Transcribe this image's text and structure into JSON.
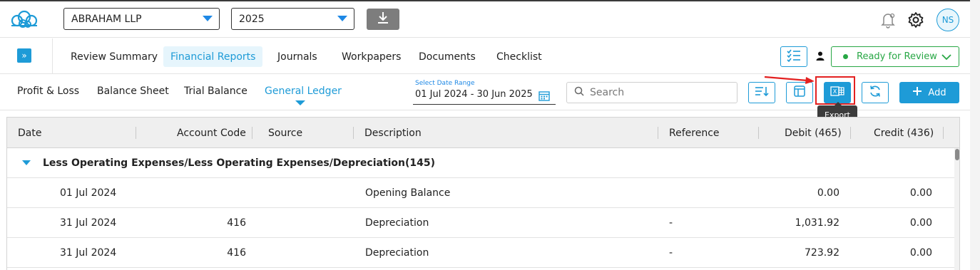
{
  "header": {
    "client_select": "ABRAHAM LLP",
    "year_select": "2025",
    "avatar_initials": "NS"
  },
  "nav": {
    "tabs": [
      "Review Summary",
      "Financial Reports",
      "Journals",
      "Workpapers",
      "Documents",
      "Checklist"
    ],
    "active_tab": "Financial Reports",
    "status_label": "Ready for Review",
    "status_color": "#28a745"
  },
  "toolbar": {
    "subtabs": [
      "Profit & Loss",
      "Balance Sheet",
      "Trial Balance",
      "General Ledger"
    ],
    "active_subtab": "General Ledger",
    "date_range_label": "Select Date Range",
    "date_range_value": "01 Jul 2024 - 30 Jun 2025",
    "search_placeholder": "Search",
    "export_tooltip": "Export",
    "add_label": "Add"
  },
  "table": {
    "columns": [
      "Date",
      "Account Code",
      "Source",
      "Description",
      "Reference",
      "Debit (465)",
      "Credit (436)"
    ],
    "group": {
      "label": "Less Operating Expenses/Less Operating Expenses/Depreciation",
      "count": "(145)"
    },
    "rows": [
      {
        "date": "01 Jul 2024",
        "account_code": "",
        "source": "",
        "description": "Opening Balance",
        "reference": "",
        "debit": "0.00",
        "credit": "0.00"
      },
      {
        "date": "31 Jul 2024",
        "account_code": "416",
        "source": "",
        "description": "Depreciation",
        "reference": "-",
        "debit": "1,031.92",
        "credit": "0.00"
      },
      {
        "date": "31 Jul 2024",
        "account_code": "416",
        "source": "",
        "description": "Depreciation",
        "reference": "-",
        "debit": "723.92",
        "credit": "0.00"
      }
    ]
  },
  "colors": {
    "accent": "#1e9bd7",
    "highlight": "#e32020"
  },
  "icons": [
    "cloud-logo-icon",
    "download-icon",
    "bell-icon",
    "gear-icon",
    "expand-icon",
    "checklist-icon",
    "user-icon",
    "chevron-down-icon",
    "calendar-icon",
    "search-icon",
    "sort-icon",
    "columns-icon",
    "excel-export-icon",
    "refresh-icon",
    "plus-icon"
  ]
}
